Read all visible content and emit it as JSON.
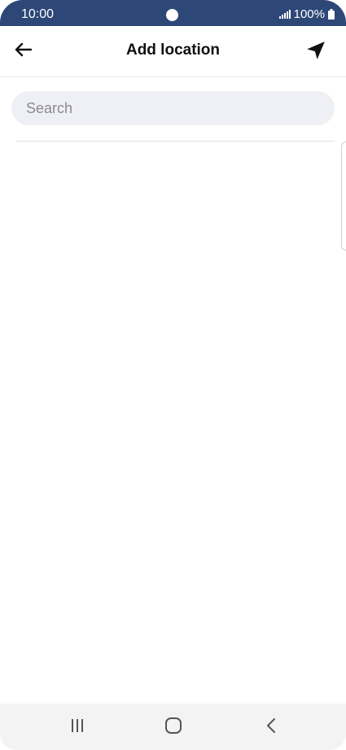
{
  "status_bar": {
    "time": "10:00",
    "battery": "100%",
    "icons": [
      "signal-icon",
      "battery-icon"
    ]
  },
  "app_bar": {
    "title": "Add location",
    "back_icon": "arrow-left-icon",
    "locate_icon": "navigation-arrow-icon"
  },
  "search": {
    "placeholder": "Search",
    "value": ""
  },
  "results": [],
  "nav_bar": {
    "icons": [
      "recent-apps-icon",
      "home-icon",
      "back-icon"
    ]
  },
  "colors": {
    "status_bar_bg": "#2d4777",
    "search_bg": "#eff0f5",
    "nav_bar_bg": "#f3f3f3"
  }
}
